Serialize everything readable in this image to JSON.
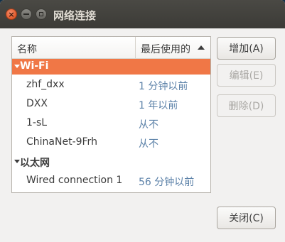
{
  "window": {
    "title": "网络连接"
  },
  "list": {
    "columns": {
      "name": "名称",
      "last_used": "最后使用的"
    },
    "groups": [
      {
        "label": "Wi-Fi",
        "selected": true,
        "items": [
          {
            "name": "zhf_dxx",
            "last_used": "1 分钟以前"
          },
          {
            "name": "DXX",
            "last_used": "1 年以前"
          },
          {
            "name": "1-sL",
            "last_used": "从不"
          },
          {
            "name": "ChinaNet-9Frh",
            "last_used": "从不"
          }
        ]
      },
      {
        "label": "以太网",
        "selected": false,
        "items": [
          {
            "name": "Wired connection 1",
            "last_used": "56 分钟以前"
          }
        ]
      }
    ]
  },
  "buttons": {
    "add": "增加(A)",
    "edit": "编辑(E)",
    "delete": "删除(D)",
    "close": "关闭(C)"
  },
  "colors": {
    "selection": "#f07746",
    "titlebar": "#3c3b37",
    "timestamp": "#5b81a8"
  }
}
